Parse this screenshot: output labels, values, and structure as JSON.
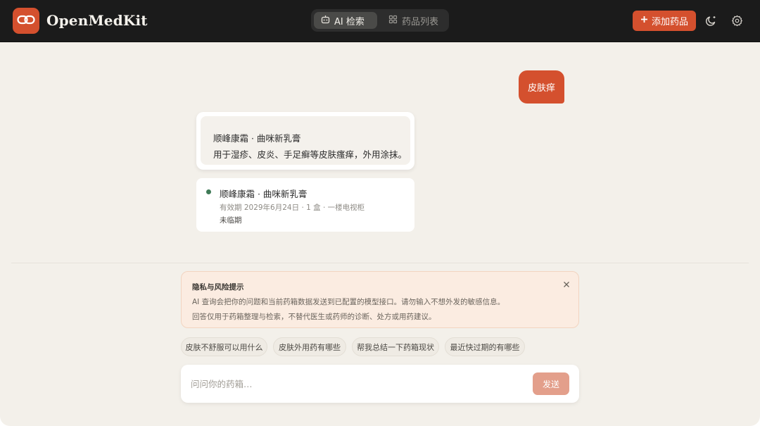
{
  "app": {
    "title": "OpenMedKit"
  },
  "nav": {
    "tabs": [
      {
        "label": "AI 检索",
        "icon": "robot-icon",
        "active": true
      },
      {
        "label": "药品列表",
        "icon": "grid-icon",
        "active": false
      }
    ],
    "add_button": "添加药品",
    "theme_icon": "moon-icon",
    "settings_icon": "gear-icon"
  },
  "chat": {
    "user_message": "皮肤痒",
    "ai_reply": {
      "line1": "顺峰康霜 · 曲咪新乳膏",
      "line2": "用于湿疹、皮炎、手足癣等皮肤瘙痒，外用涂抹。"
    },
    "medicine_card": {
      "name": "顺峰康霜 · 曲咪新乳膏",
      "meta": "有效期 2029年6月24日 · 1 盒 · 一楼电视柜",
      "status": "未临期",
      "status_color": "#3f7a57"
    }
  },
  "notice": {
    "title": "隐私与风险提示",
    "line1": "AI 查询会把你的问题和当前药箱数据发送到已配置的模型接口。请勿输入不想外发的敏感信息。",
    "line2": "回答仅用于药箱整理与检索，不替代医生或药师的诊断、处方或用药建议。"
  },
  "suggestions": [
    "皮肤不舒服可以用什么",
    "皮肤外用药有哪些",
    "帮我总结一下药箱现状",
    "最近快过期的有哪些"
  ],
  "composer": {
    "placeholder": "问问你的药箱…",
    "send_label": "发送"
  },
  "colors": {
    "accent": "#d4502e",
    "header_bg": "#1b1b1b",
    "page_bg": "#f3f0ea",
    "notice_bg": "#fbece1",
    "send_disabled": "#e39f8b"
  }
}
